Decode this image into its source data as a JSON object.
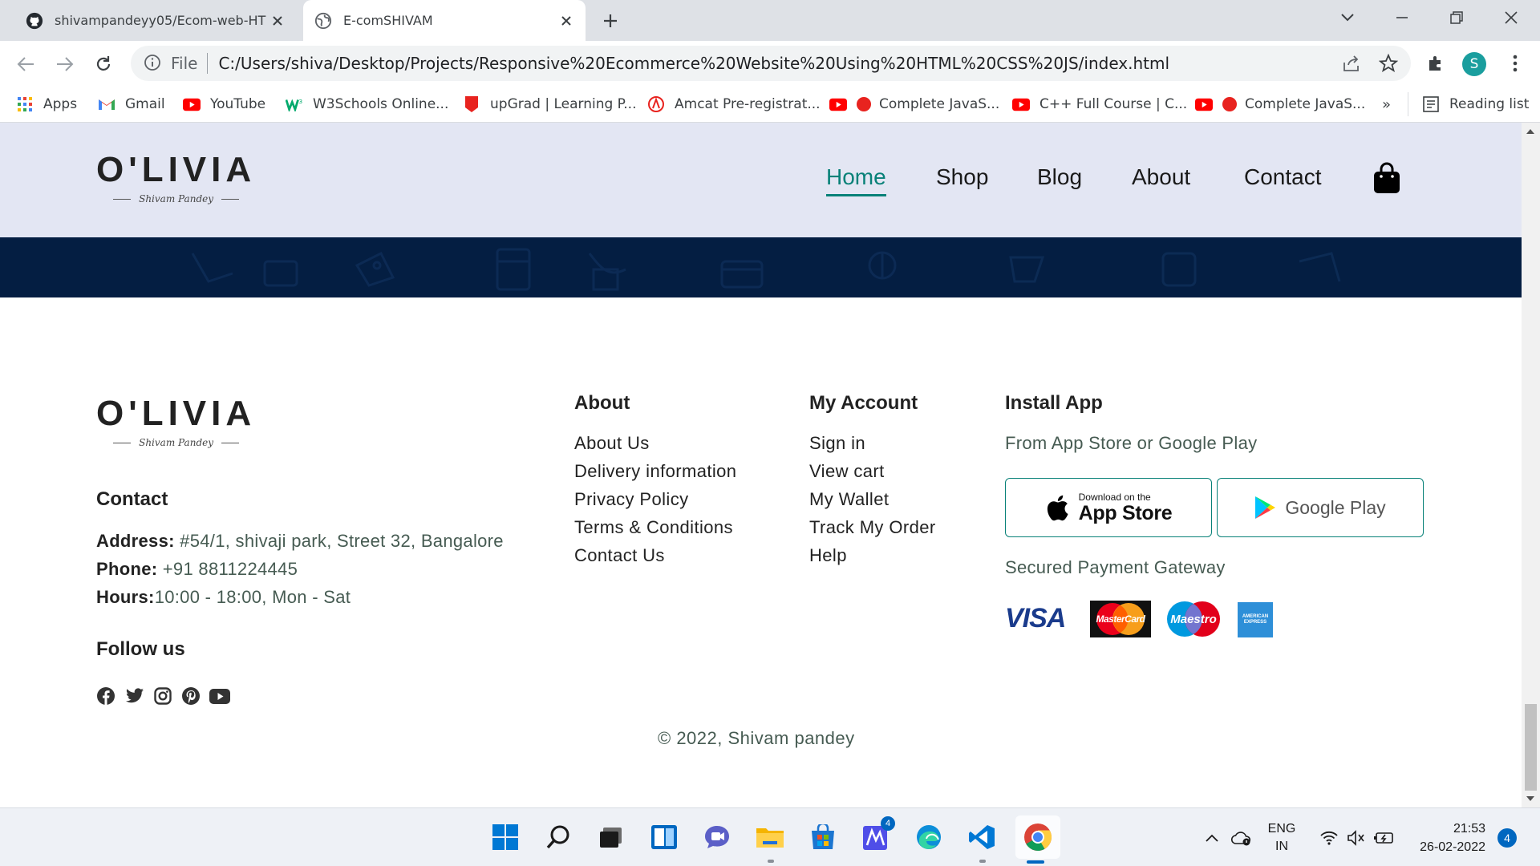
{
  "browser": {
    "tabs": [
      {
        "title": "shivampandeyy05/Ecom-web-HT",
        "icon": "github-icon",
        "active": false
      },
      {
        "title": "E-comSHIVAM",
        "icon": "globe-icon",
        "active": true
      }
    ],
    "address": {
      "scheme_label": "File",
      "url": "C:/Users/shiva/Desktop/Projects/Responsive%20Ecommerce%20Website%20Using%20HTML%20CSS%20JS/index.html"
    },
    "profile_initial": "S",
    "bookmarks": [
      "Apps",
      "Gmail",
      "YouTube",
      "W3Schools Online...",
      "upGrad | Learning P...",
      "Amcat Pre-registrat...",
      "Complete JavaS...",
      "C++ Full Course | C...",
      "Complete JavaS..."
    ],
    "bookmarks_overflow": "»",
    "reading_list": "Reading list"
  },
  "site": {
    "brand": {
      "wordmark": "O'LIVIA",
      "signature": "Shivam Pandey"
    },
    "nav": [
      {
        "label": "Home",
        "active": true
      },
      {
        "label": "Shop",
        "active": false
      },
      {
        "label": "Blog",
        "active": false
      },
      {
        "label": "About",
        "active": false
      },
      {
        "label": "Contact",
        "active": false
      }
    ],
    "colors": {
      "accent": "#088178",
      "header_bg": "#e3e6f3",
      "banner_bg": "#041e42"
    },
    "footer": {
      "contact_heading": "Contact",
      "address_label": "Address:",
      "address_value": " #54/1, shivaji park, Street 32, Bangalore",
      "phone_label": "Phone:",
      "phone_value": " +91 8811224445",
      "hours_label": "Hours:",
      "hours_value": "10:00 - 18:00, Mon - Sat",
      "follow_heading": "Follow us",
      "social_icons": [
        "facebook-icon",
        "twitter-icon",
        "instagram-icon",
        "pinterest-icon",
        "youtube-icon"
      ],
      "about_heading": "About",
      "about_links": [
        "About Us",
        "Delivery information",
        "Privacy Policy",
        "Terms & Conditions",
        "Contact Us"
      ],
      "account_heading": "My Account",
      "account_links": [
        "Sign in",
        "View cart",
        "My Wallet",
        "Track My Order",
        "Help"
      ],
      "install_heading": "Install App",
      "install_sub": "From App Store or Google Play",
      "appstore_small": "Download on the",
      "appstore_big": "App Store",
      "googleplay": "Google Play",
      "payment_heading": "Secured Payment Gateway",
      "payment_visa": "VISA",
      "payment_mastercard": "MasterCard",
      "payment_maestro": "Maestro",
      "payment_amex": "AMERICAN EXPRESS",
      "copyright": "© 2022, Shivam pandey"
    }
  },
  "taskbar": {
    "apps": [
      "start-icon",
      "search-icon",
      "task-view-icon",
      "widgets-icon",
      "teams-chat-icon",
      "file-explorer-icon",
      "store-icon",
      "pen-app-icon",
      "edge-icon",
      "vscode-icon",
      "chrome-icon"
    ],
    "pen_app_badge": "4",
    "lang_top": "ENG",
    "lang_bottom": "IN",
    "time": "21:53",
    "date": "26-02-2022",
    "notification_count": "4"
  }
}
